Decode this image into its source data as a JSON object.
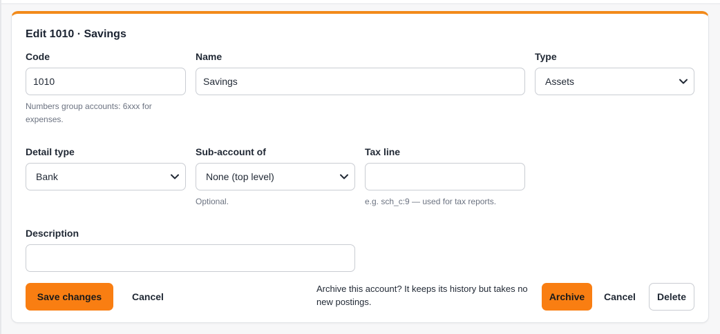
{
  "form": {
    "title": "Edit 1010 · Savings",
    "code": {
      "label": "Code",
      "value": "1010",
      "hint": "Numbers group accounts: 6xxx for expenses."
    },
    "name": {
      "label": "Name",
      "value": "Savings"
    },
    "type": {
      "label": "Type",
      "selected": "Assets"
    },
    "detail_type": {
      "label": "Detail type",
      "selected": "Bank"
    },
    "sub_account": {
      "label": "Sub-account of",
      "selected": "None (top level)",
      "hint": "Optional."
    },
    "tax_line": {
      "label": "Tax line",
      "value": "",
      "hint": "e.g. sch_c:9 — used for tax reports."
    },
    "description": {
      "label": "Description",
      "value": ""
    }
  },
  "actions": {
    "save_label": "Save changes",
    "cancel_label": "Cancel",
    "archive_prompt": "Archive this account? It keeps its history but takes no new postings.",
    "archive_label": "Archive",
    "archive_cancel_label": "Cancel",
    "delete_label": "Delete"
  },
  "colors": {
    "accent": "#f97e12",
    "card_top_border": "#f28a1a"
  },
  "icons": {
    "select_chevron": "chevron-down-icon"
  }
}
